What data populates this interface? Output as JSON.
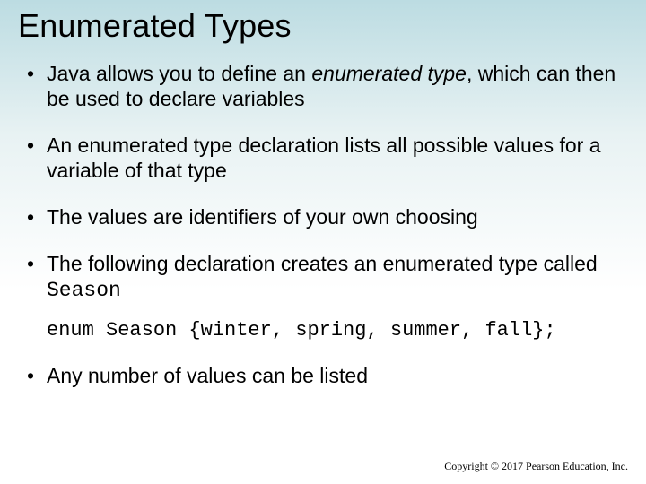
{
  "title": "Enumerated Types",
  "bullets": {
    "b1_a": "Java allows you to define an ",
    "b1_em": "enumerated type",
    "b1_b": ", which can then be used to declare variables",
    "b2": "An enumerated type declaration lists all possible values for a variable of that type",
    "b3": "The values are identifiers of your own choosing",
    "b4_a": "The following declaration creates an enumerated type called ",
    "b4_code": "Season",
    "code": "enum Season {winter, spring, summer, fall};",
    "b5": "Any number of values can be listed"
  },
  "copyright": "Copyright © 2017 Pearson Education, Inc."
}
